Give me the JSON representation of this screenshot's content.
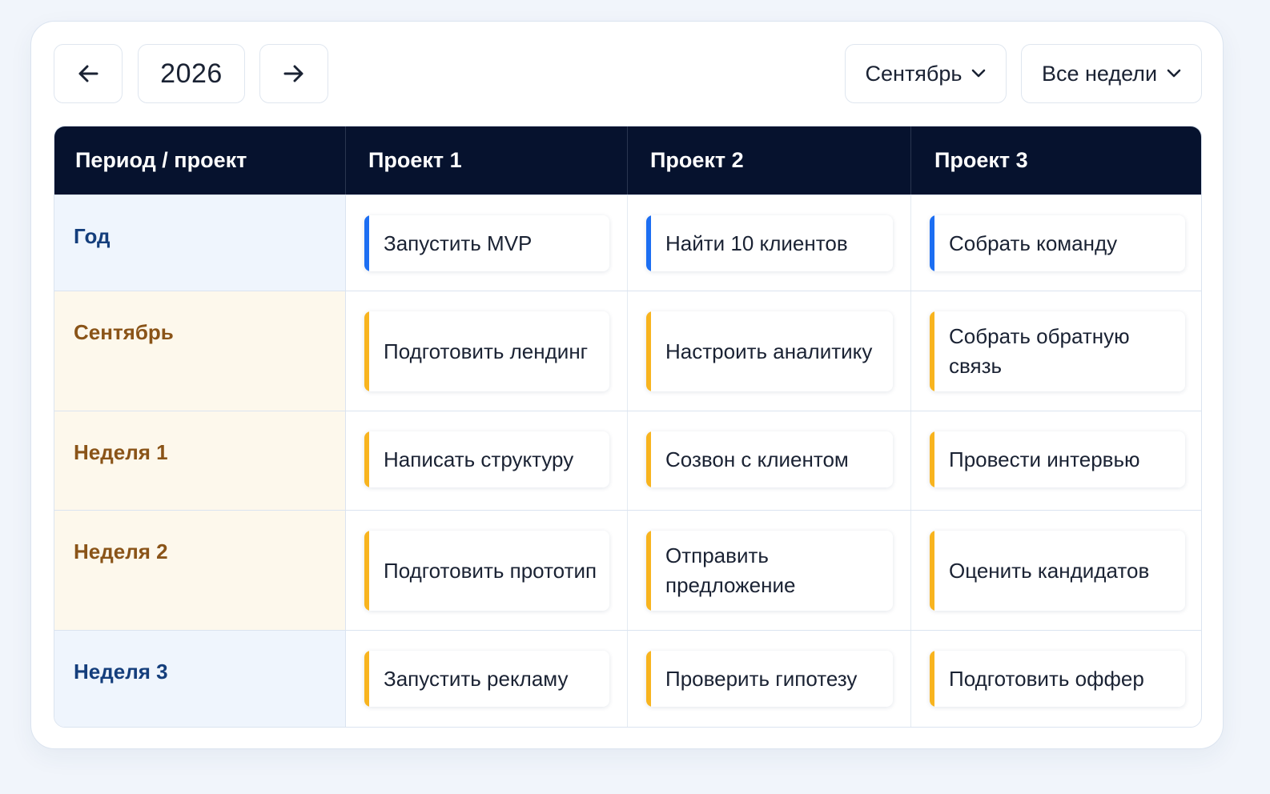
{
  "toolbar": {
    "prev_icon": "arrow-left-icon",
    "year": "2026",
    "next_icon": "arrow-right-icon",
    "month_label": "Сентябрь",
    "weeks_label": "Все недели",
    "dropdown_icon": "chevron-down-icon"
  },
  "table": {
    "headers": [
      "Период / проект",
      "Проект 1",
      "Проект 2",
      "Проект 3"
    ],
    "rows": [
      {
        "period": "Год",
        "tone": "blue",
        "tasks": [
          "Запустить MVP",
          "Найти 10 клиентов",
          "Собрать команду"
        ]
      },
      {
        "period": "Сентябрь",
        "tone": "beige",
        "tasks": [
          "Подготовить лендинг",
          "Настроить аналитику",
          "Собрать обратную связь"
        ]
      },
      {
        "period": "Неделя 1",
        "tone": "beige",
        "tasks": [
          "Написать структуру",
          "Созвон с клиентом",
          "Провести интервью"
        ]
      },
      {
        "period": "Неделя 2",
        "tone": "beige",
        "tasks": [
          "Подготовить прототип",
          "Отправить предложение",
          "Оценить кандидатов"
        ]
      },
      {
        "period": "Неделя 3",
        "tone": "blue",
        "tasks": [
          "Запустить рекламу",
          "Проверить гипотезу",
          "Подготовить оффер"
        ]
      }
    ]
  },
  "colors": {
    "header_bg": "#06122e",
    "year_accent": "#1c6ef2",
    "period_accent": "#f8b41f",
    "year_label": "#143e7c",
    "period_label": "#8a5418"
  }
}
